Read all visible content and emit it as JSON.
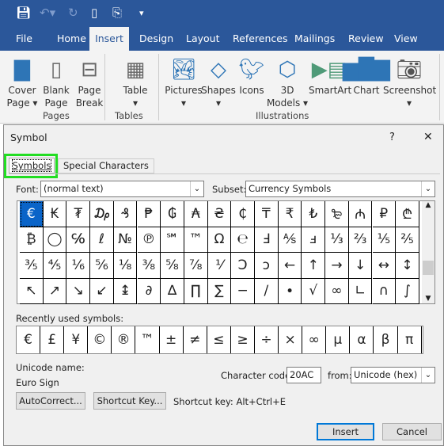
{
  "qat": {
    "icons": [
      "save-icon",
      "undo-icon",
      "redo-icon",
      "new-document-icon",
      "attach-icon",
      "customize-icon"
    ]
  },
  "tabs": [
    "File",
    "Home",
    "Insert",
    "Design",
    "Layout",
    "References",
    "Mailings",
    "Review",
    "View"
  ],
  "active_tab": "Insert",
  "ribbon": {
    "buttons": [
      {
        "label": "Cover",
        "label2": "Page ▾"
      },
      {
        "label": "Blank",
        "label2": "Page"
      },
      {
        "label": "Page",
        "label2": "Break"
      },
      {
        "label": "Table",
        "label2": "▾"
      },
      {
        "label": "Pictures",
        "label2": "▾"
      },
      {
        "label": "Shapes",
        "label2": "▾"
      },
      {
        "label": "Icons",
        "label2": ""
      },
      {
        "label": "3D",
        "label2": "Models ▾"
      },
      {
        "label": "SmartArt",
        "label2": ""
      },
      {
        "label": "Chart",
        "label2": ""
      },
      {
        "label": "Screenshot",
        "label2": "▾"
      }
    ],
    "groups": [
      "Pages",
      "Tables",
      "Illustrations"
    ]
  },
  "dialog": {
    "title": "Symbol",
    "help": "?",
    "close": "✕",
    "tabs": [
      "Symbols",
      "Special Characters"
    ],
    "font_label": "Font:",
    "font_value": "(normal text)",
    "subset_label": "Subset:",
    "subset_value": "Currency Symbols",
    "symbols": [
      [
        "€",
        "₭",
        "₮",
        "₯",
        "₰",
        "₱",
        "₲",
        "₳",
        "₴",
        "₵",
        "₸",
        "₹",
        "₺",
        "₻",
        "₼",
        "₽",
        "₾"
      ],
      [
        "₿",
        "◯",
        "℅",
        "ℓ",
        "№",
        "℗",
        "℠",
        "™",
        "Ω",
        "℮",
        "Ⅎ",
        "⅍",
        "ⅎ",
        "⅓",
        "⅔",
        "⅕",
        "⅖"
      ],
      [
        "⅗",
        "⅘",
        "⅙",
        "⅚",
        "⅛",
        "⅜",
        "⅝",
        "⅞",
        "⅟",
        "Ↄ",
        "ↄ",
        "←",
        "↑",
        "→",
        "↓",
        "↔",
        "↕"
      ],
      [
        "↖",
        "↗",
        "↘",
        "↙",
        "↨",
        "∂",
        "∆",
        "∏",
        "∑",
        "−",
        "∕",
        "∙",
        "√",
        "∞",
        "∟",
        "∩",
        "∫"
      ]
    ],
    "selected": "€",
    "recent_label": "Recently used symbols:",
    "recent": [
      "€",
      "£",
      "¥",
      "©",
      "®",
      "™",
      "±",
      "≠",
      "≤",
      "≥",
      "÷",
      "×",
      "∞",
      "µ",
      "α",
      "β",
      "π"
    ],
    "unicode_name_label": "Unicode name:",
    "unicode_name": "Euro Sign",
    "char_code_label": "Character code:",
    "char_code": "20AC",
    "from_label": "from:",
    "from_value": "Unicode (hex)",
    "autocorrect": "AutoCorrect...",
    "shortcut_key_btn": "Shortcut Key...",
    "shortcut_text": "Shortcut key: Alt+Ctrl+E",
    "insert": "Insert",
    "cancel": "Cancel"
  }
}
